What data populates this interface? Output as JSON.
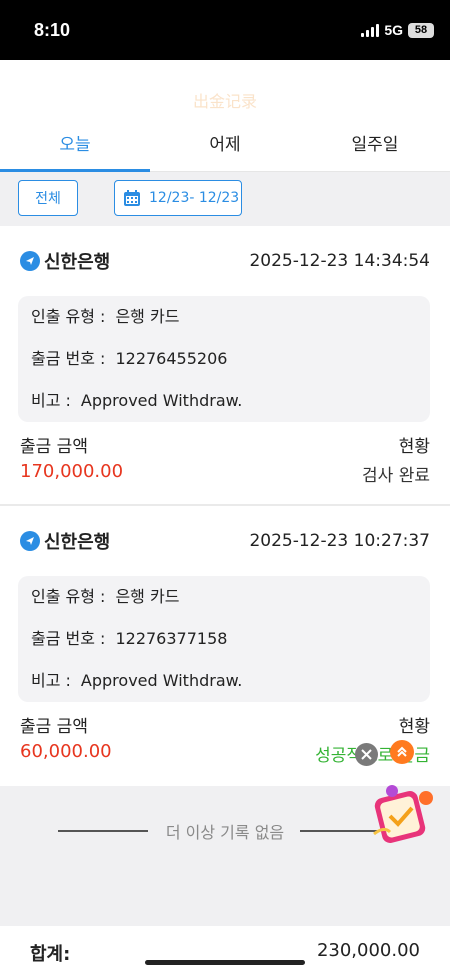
{
  "status_bar": {
    "time": "8:10",
    "network": "5G",
    "battery": "58"
  },
  "header": {
    "title": "出金记录"
  },
  "tabs": [
    {
      "label": "오늘",
      "active": true
    },
    {
      "label": "어제",
      "active": false
    },
    {
      "label": "일주일",
      "active": false
    }
  ],
  "filter": {
    "all_label": "전체",
    "date_range": "12/23- 12/23"
  },
  "records": [
    {
      "bank": "신한은행",
      "datetime": "2025-12-23 14:34:54",
      "type_label": "인출 유형 :",
      "type_value": "은행 카드",
      "number_label": "출금 번호 :",
      "number_value": "12276455206",
      "note_label": "비고 :",
      "note_value": "Approved Withdraw.",
      "amount_label": "출금 금액",
      "status_label": "현황",
      "amount": "170,000.00",
      "status": "검사 완료"
    },
    {
      "bank": "신한은행",
      "datetime": "2025-12-23 10:27:37",
      "type_label": "인출 유형 :",
      "type_value": "은행 카드",
      "number_label": "출금 번호 :",
      "number_value": "12276377158",
      "note_label": "비고 :",
      "note_value": "Approved Withdraw.",
      "amount_label": "출금 금액",
      "status_label": "현황",
      "amount": "60,000.00",
      "status": "성공적으로 출금"
    }
  ],
  "end_message": "더 이상 기록 없음",
  "footer": {
    "total_label": "합계:",
    "total_value": "230,000.00"
  },
  "colors": {
    "accent": "#2b8de3",
    "amount": "#e7361f",
    "success": "#34b334"
  },
  "icons": [
    "signal-icon",
    "battery-icon",
    "calendar-icon",
    "bank-logo-icon",
    "close-icon",
    "scroll-top-icon",
    "promo-gift-icon"
  ]
}
